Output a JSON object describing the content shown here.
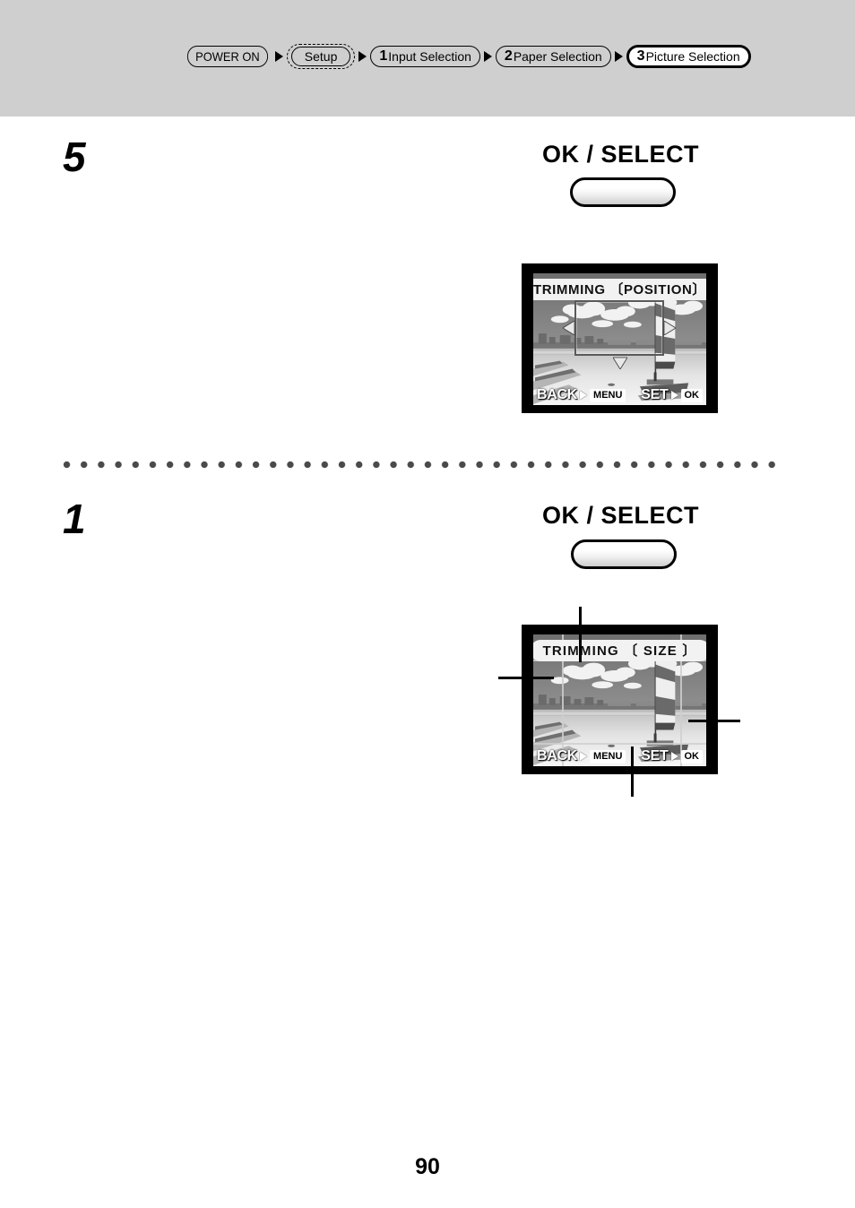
{
  "header": {
    "breadcrumb": [
      {
        "label": "POWER ON",
        "num": "",
        "style": "solid"
      },
      {
        "label": "Setup",
        "num": "",
        "style": "dashed"
      },
      {
        "label": "Input Selection",
        "num": "1",
        "style": "solid"
      },
      {
        "label": "Paper Selection",
        "num": "2",
        "style": "solid"
      },
      {
        "label": "Picture Selection",
        "num": "3",
        "style": "active"
      }
    ]
  },
  "steps": [
    {
      "number": "5",
      "button_label": "OK / SELECT",
      "screen": {
        "title": "TRIMMING 〔POSITION〕",
        "footer_left_word": "BACK",
        "footer_left_key": "MENU",
        "footer_right_word": "SET",
        "footer_right_key": "OK"
      }
    },
    {
      "number": "1",
      "button_label": "OK / SELECT",
      "screen": {
        "title": "TRIMMING 〔 SIZE 〕",
        "footer_left_word": "BACK",
        "footer_left_key": "MENU",
        "footer_right_word": "SET",
        "footer_right_key": "OK"
      }
    }
  ],
  "footer": {
    "page_number": "90"
  },
  "colors": {
    "header_band": "#cfcfcf",
    "page_background": "#ffffff",
    "lcd_bezel": "#000000",
    "text": "#000000",
    "separator_dot": "#4a4a4a"
  }
}
